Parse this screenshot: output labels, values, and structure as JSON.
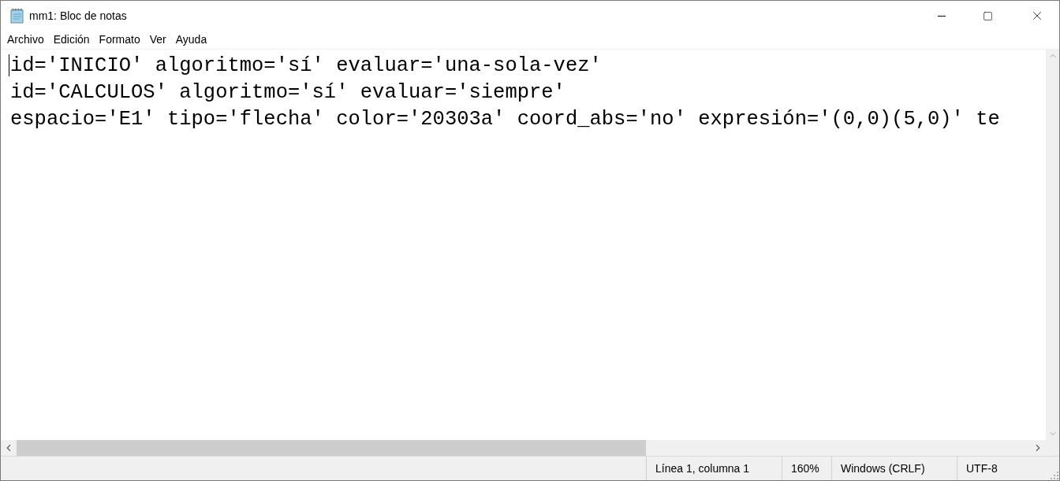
{
  "window": {
    "title": "mm1: Bloc de notas"
  },
  "menu": [
    "Archivo",
    "Edición",
    "Formato",
    "Ver",
    "Ayuda"
  ],
  "editor": {
    "lines": [
      "id='INICIO' algoritmo='sí' evaluar='una-sola-vez'",
      "id='CALCULOS' algoritmo='sí' evaluar='siempre'",
      "espacio='E1' tipo='flecha' color='20303a' coord_abs='no' expresión='(0,0)(5,0)' te"
    ]
  },
  "status_bar": [
    "Línea 1, columna 1",
    "160%",
    "Windows (CRLF)",
    "UTF-8"
  ]
}
